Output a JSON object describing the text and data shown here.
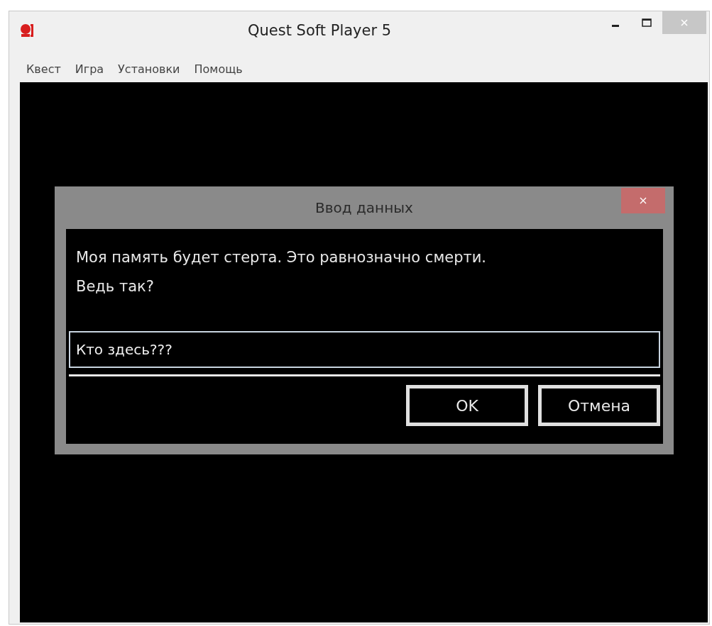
{
  "window": {
    "title": "Quest Soft Player 5"
  },
  "menu": [
    {
      "label": "Квест"
    },
    {
      "label": "Игра"
    },
    {
      "label": "Установки"
    },
    {
      "label": "Помощь"
    }
  ],
  "dialog": {
    "title": "Ввод данных",
    "message": "Моя память будет стерта. Это равнозначно смерти.\nВедь так?",
    "input": {
      "value": "Кто здесь???"
    },
    "buttons": [
      {
        "label": "OK"
      },
      {
        "label": "Отмена"
      }
    ]
  }
}
